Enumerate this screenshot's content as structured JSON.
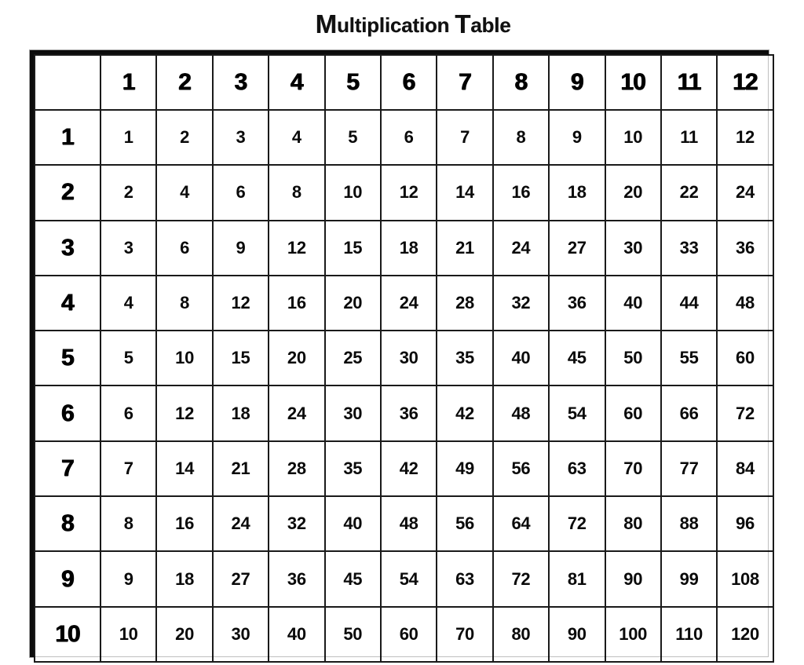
{
  "title": {
    "full": "Multiplication Table",
    "part1_initial": "M",
    "part1_rest": "ultiplication",
    "space": " ",
    "part2_initial": "T",
    "part2_rest": "able"
  },
  "table": {
    "corner_label": "",
    "column_headers": [
      "1",
      "2",
      "3",
      "4",
      "5",
      "6",
      "7",
      "8",
      "9",
      "10",
      "11",
      "12"
    ],
    "row_headers": [
      "1",
      "2",
      "3",
      "4",
      "5",
      "6",
      "7",
      "8",
      "9",
      "10"
    ],
    "rows": [
      [
        "1",
        "2",
        "3",
        "4",
        "5",
        "6",
        "7",
        "8",
        "9",
        "10",
        "11",
        "12"
      ],
      [
        "2",
        "4",
        "6",
        "8",
        "10",
        "12",
        "14",
        "16",
        "18",
        "20",
        "22",
        "24"
      ],
      [
        "3",
        "6",
        "9",
        "12",
        "15",
        "18",
        "21",
        "24",
        "27",
        "30",
        "33",
        "36"
      ],
      [
        "4",
        "8",
        "12",
        "16",
        "20",
        "24",
        "28",
        "32",
        "36",
        "40",
        "44",
        "48"
      ],
      [
        "5",
        "10",
        "15",
        "20",
        "25",
        "30",
        "35",
        "40",
        "45",
        "50",
        "55",
        "60"
      ],
      [
        "6",
        "12",
        "18",
        "24",
        "30",
        "36",
        "42",
        "48",
        "54",
        "60",
        "66",
        "72"
      ],
      [
        "7",
        "14",
        "21",
        "28",
        "35",
        "42",
        "49",
        "56",
        "63",
        "70",
        "77",
        "84"
      ],
      [
        "8",
        "16",
        "24",
        "32",
        "40",
        "48",
        "56",
        "64",
        "72",
        "80",
        "88",
        "96"
      ],
      [
        "9",
        "18",
        "27",
        "36",
        "45",
        "54",
        "63",
        "72",
        "81",
        "90",
        "99",
        "108"
      ],
      [
        "10",
        "20",
        "30",
        "40",
        "50",
        "60",
        "70",
        "80",
        "90",
        "100",
        "110",
        "120"
      ]
    ]
  },
  "colors": {
    "ink": "#000000",
    "paper": "#ffffff",
    "grid_line": "#1a1a1a",
    "outer_border": "#0c0c0c"
  }
}
